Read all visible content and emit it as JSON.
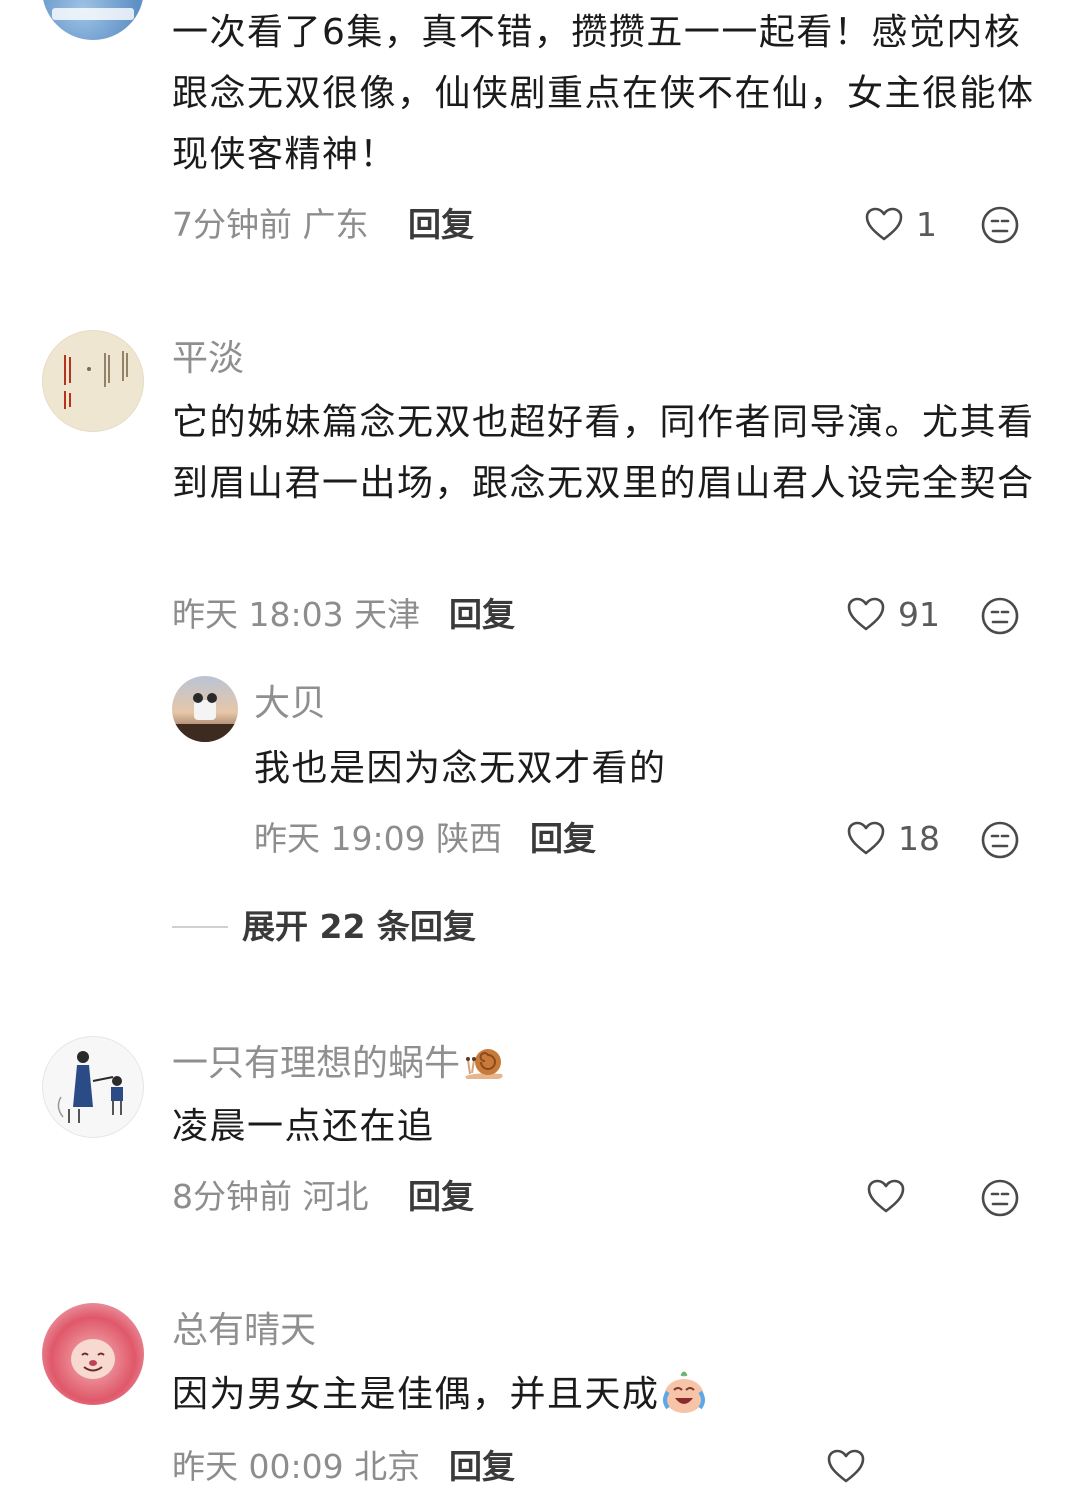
{
  "comments": [
    {
      "content": "一次看了6集，真不错，攒攒五一一起看！感觉内核跟念无双很像，仙侠剧重点在侠不在仙，女主很能体现侠客精神！",
      "meta": "7分钟前 广东",
      "reply_label": "回复",
      "like_count": "1"
    },
    {
      "username": "平淡",
      "content": "它的姊妹篇念无双也超好看，同作者同导演。尤其看到眉山君一出场，跟念无双里的眉山君人设完全契合",
      "meta": "昨天 18:03 天津",
      "reply_label": "回复",
      "like_count": "91"
    },
    {
      "username": "大贝",
      "content": "我也是因为念无双才看的",
      "meta": "昨天 19:09 陕西",
      "reply_label": "回复",
      "like_count": "18"
    },
    {
      "username": "一只有理想的蜗牛",
      "content": "凌晨一点还在追",
      "meta": "8分钟前 河北",
      "reply_label": "回复",
      "like_count": ""
    },
    {
      "username": "总有晴天",
      "content": "因为男女主是佳偶，并且天成",
      "meta": "昨天 00:09 北京",
      "reply_label": "回复",
      "like_count": ""
    }
  ],
  "expand_replies": "展开 22 条回复",
  "colors": {
    "username": "#8f8f8f",
    "content": "#1b1b1b",
    "meta": "#8d8d8d",
    "icon": "#4a4a4a"
  },
  "icons": [
    "heart-icon",
    "expression-icon",
    "snail-emoji",
    "crying-laughing-emoji"
  ]
}
